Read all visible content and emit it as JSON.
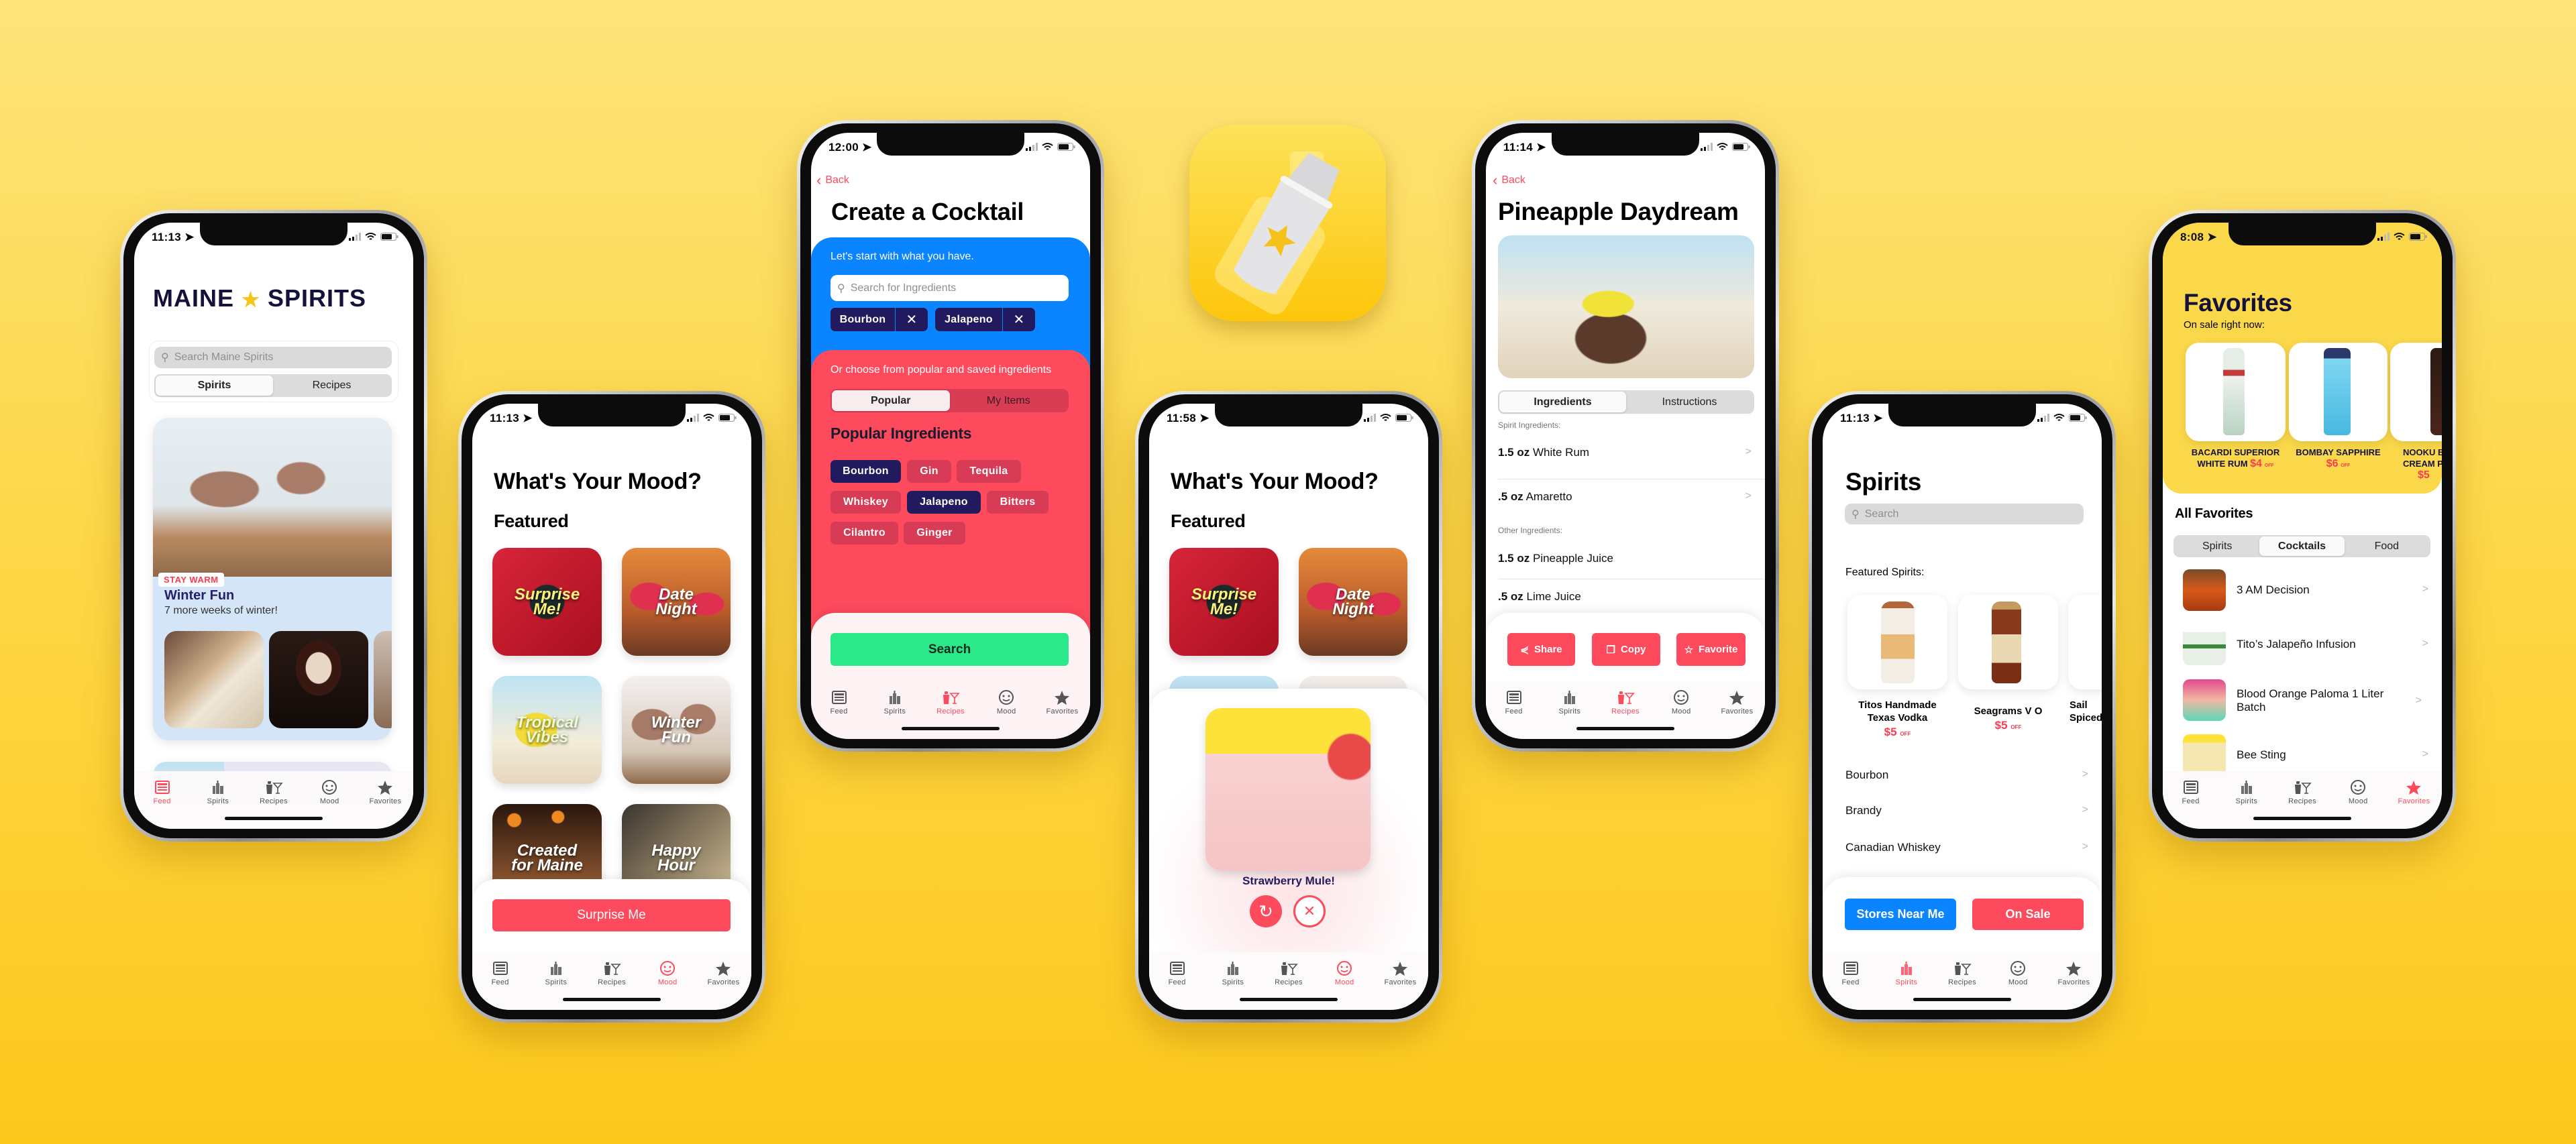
{
  "colors": {
    "accent_red": "#fd4a5c",
    "navy": "#221a5e",
    "blue": "#0a84ff",
    "green": "#2be88a",
    "favorites_yellow": "#fbd84a",
    "background_yellow": "#fdd84a"
  },
  "tab_labels": [
    "Feed",
    "Spirits",
    "Recipes",
    "Mood",
    "Favorites"
  ],
  "tab_icons": [
    "feed-icon",
    "spirits-bottles-icon",
    "recipes-shaker-icon",
    "mood-face-icon",
    "favorites-star-icon"
  ],
  "app_icon": {
    "name": "cocktail-shaker-app-icon"
  },
  "phones": {
    "feed": {
      "time": "11:13",
      "active_tab": 0,
      "logo_left": "MAINE",
      "logo_right": "SPIRITS",
      "search_placeholder": "Search Maine Spirits",
      "segments": [
        "Spirits",
        "Recipes"
      ],
      "card": {
        "badge": "STAY WARM",
        "title": "Winter Fun",
        "subtitle": "7 more weeks of winter!"
      }
    },
    "mood": {
      "time": "11:13",
      "active_tab": 3,
      "title": "What's Your Mood?",
      "section": "Featured",
      "tiles": [
        "Surprise Me!",
        "Date Night",
        "Tropical Vibes",
        "Winter Fun",
        "Created for Maine",
        "Happy Hour"
      ],
      "button": "Surprise Me"
    },
    "create": {
      "time": "12:00",
      "active_tab": 2,
      "back": "Back",
      "title": "Create a Cocktail",
      "prompt": "Let's start with what you have.",
      "search_placeholder": "Search for Ingredients",
      "selected": [
        "Bourbon",
        "Jalapeno"
      ],
      "choose_prompt": "Or choose from popular and saved ingredients",
      "segments": [
        "Popular",
        "My Items"
      ],
      "section": "Popular Ingredients",
      "chips": [
        {
          "label": "Bourbon",
          "selected": true
        },
        {
          "label": "Gin",
          "selected": false
        },
        {
          "label": "Tequila",
          "selected": false
        },
        {
          "label": "Whiskey",
          "selected": false
        },
        {
          "label": "Jalapeno",
          "selected": true
        },
        {
          "label": "Bitters",
          "selected": false
        },
        {
          "label": "Cilantro",
          "selected": false
        },
        {
          "label": "Ginger",
          "selected": false
        }
      ],
      "button": "Search"
    },
    "surprise": {
      "time": "11:58",
      "active_tab": 3,
      "title": "What's Your Mood?",
      "section": "Featured",
      "tiles": [
        "Surprise Me!",
        "Date Night"
      ],
      "result": "Strawberry Mule!"
    },
    "recipe": {
      "time": "11:14",
      "active_tab": 2,
      "back": "Back",
      "title": "Pineapple Daydream",
      "segments": [
        "Ingredients",
        "Instructions"
      ],
      "spirit_header": "Spirit Ingredients:",
      "spirit_items": [
        {
          "amount": "1.5 oz",
          "name": "White Rum"
        },
        {
          "amount": ".5 oz",
          "name": "Amaretto"
        }
      ],
      "other_header": "Other Ingredients:",
      "other_items": [
        {
          "amount": "1.5 oz",
          "name": "Pineapple Juice"
        },
        {
          "amount": ".5 oz",
          "name": "Lime Juice"
        }
      ],
      "buttons": [
        "Share",
        "Copy",
        "Favorite"
      ]
    },
    "spirits": {
      "time": "11:13",
      "active_tab": 1,
      "title": "Spirits",
      "search_placeholder": "Search",
      "featured_label": "Featured Spirits:",
      "featured": [
        {
          "name": "Titos Handmade Texas Vodka",
          "price": "$5",
          "off": "OFF"
        },
        {
          "name": "Seagrams V O",
          "price": "$5",
          "off": "OFF"
        },
        {
          "name": "Sail Spiced",
          "price": "$",
          "off": ""
        }
      ],
      "categories": [
        "Bourbon",
        "Brandy",
        "Canadian Whiskey"
      ],
      "buttons": [
        "Stores Near Me",
        "On Sale"
      ]
    },
    "favorites": {
      "time": "8:08",
      "active_tab": 4,
      "title": "Favorites",
      "on_sale": "On sale right now:",
      "sale_items": [
        {
          "name": "BACARDI SUPERIOR WHITE RUM",
          "price": "$4",
          "off": "OFF"
        },
        {
          "name": "BOMBAY SAPPHIRE",
          "price": "$6",
          "off": "OFF"
        },
        {
          "name": "NOOKU BO CREAM PEP",
          "price": "$5",
          "off": ""
        }
      ],
      "all_label": "All Favorites",
      "segments": [
        "Spirits",
        "Cocktails",
        "Food"
      ],
      "items": [
        "3 AM Decision",
        "Tito’s Jalapeño Infusion",
        "Blood Orange Paloma 1 Liter Batch",
        "Bee Sting"
      ]
    }
  }
}
